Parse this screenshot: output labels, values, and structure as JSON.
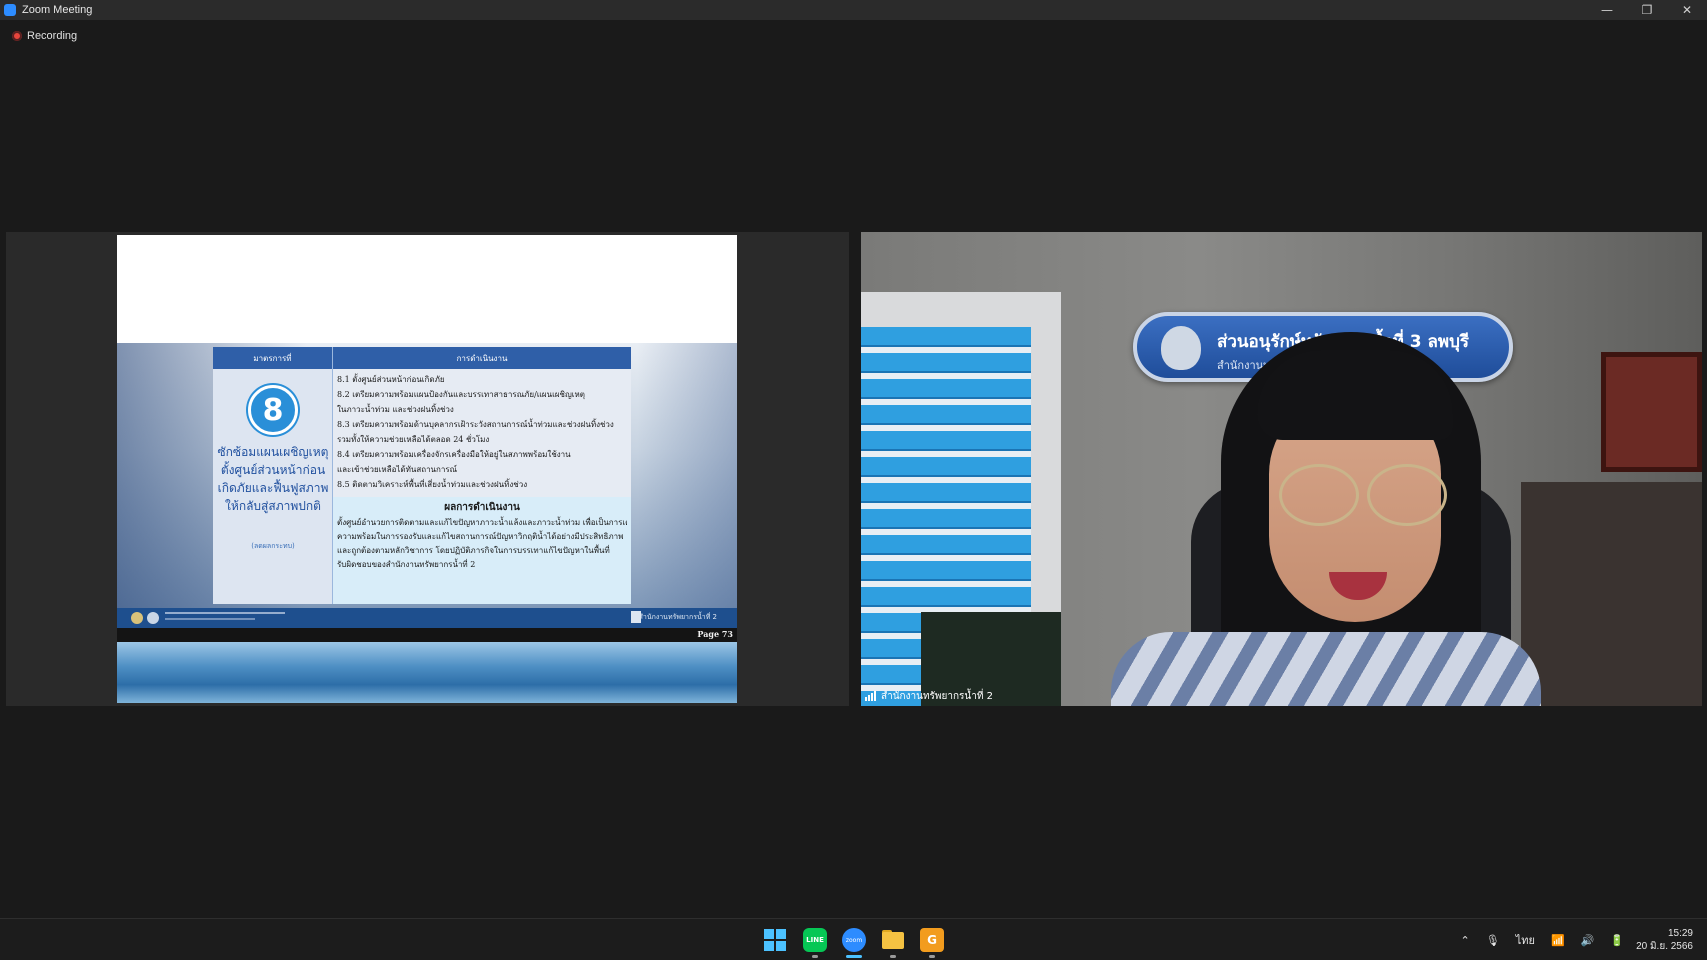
{
  "window": {
    "title": "Zoom Meeting",
    "minimize_glyph": "—",
    "maximize_glyph": "❐",
    "close_glyph": "✕"
  },
  "recording": {
    "label": "Recording"
  },
  "slide": {
    "header_col1": "มาตรการที่",
    "header_col2": "การดำเนินงาน",
    "measure_number": "8",
    "measure_title": "ซักซ้อมแผนเผชิญเหตุ ตั้งศูนย์ส่วนหน้าก่อน เกิดภัยและฟื้นฟูสภาพ ให้กลับสู่สภาพปกติ",
    "measure_subtitle": "(ลดผลกระทบ)",
    "steps": [
      "8.1 ตั้งศูนย์ส่วนหน้าก่อนเกิดภัย",
      "8.2 เตรียมความพร้อมแผนป้องกันและบรรเทาสาธารณภัย/แผนเผชิญเหตุ",
      "ในภาวะน้ำท่วม และช่วงฝนทิ้งช่วง",
      "8.3 เตรียมความพร้อมด้านบุคลากรเฝ้าระวังสถานการณ์น้ำท่วมและช่วงฝนทิ้งช่วง",
      "รวมทั้งให้ความช่วยเหลือได้ตลอด 24 ชั่วโมง",
      "8.4 เตรียมความพร้อมเครื่องจักรเครื่องมือให้อยู่ในสภาพพร้อมใช้งาน",
      "และเข้าช่วยเหลือได้ทันสถานการณ์",
      "8.5 ติดตามวิเคราะห์พื้นที่เสี่ยงน้ำท่วมและช่วงฝนทิ้งช่วง"
    ],
    "result_title": "ผลการดำเนินงาน",
    "result_lines": [
      "ตั้งศูนย์อำนวยการติดตามและแก้ไขปัญหาภาวะน้ำแล้งและภาวะน้ำท่วม เพื่อเป็นการเตรียม",
      "ความพร้อมในการรองรับและแก้ไขสถานการณ์ปัญหาวิกฤติน้ำได้อย่างมีประสิทธิภาพ",
      "และถูกต้องตามหลักวิชาการ โดยปฏิบัติภารกิจในการบรรเทาแก้ไขปัญหาในพื้นที่",
      "รับผิดชอบของสำนักงานทรัพยากรน้ำที่ 2"
    ],
    "footer_org": "สำนักงานทรัพยากรน้ำที่ 2",
    "page_label": "Page 73"
  },
  "video": {
    "participant_name": "สำนักงานทรัพยากรน้ำที่ 2",
    "sign_line1": "ส่วนอนุรักษ์ทรัพยากรน้ำที่ 3 ลพบุรี",
    "sign_line2": "สำนักงานทรัพยากรน้ำ"
  },
  "taskbar": {
    "line_label": "LINE",
    "zoom_label": "zoom",
    "slides_label": "G",
    "tray_chevron": "⌃",
    "mic_glyph": "🎙",
    "language": "ไทย",
    "wifi_glyph": "📶",
    "volume_glyph": "🔊",
    "battery_glyph": "🔋",
    "time": "15:29",
    "date": "20 มิ.ย. 2566"
  }
}
